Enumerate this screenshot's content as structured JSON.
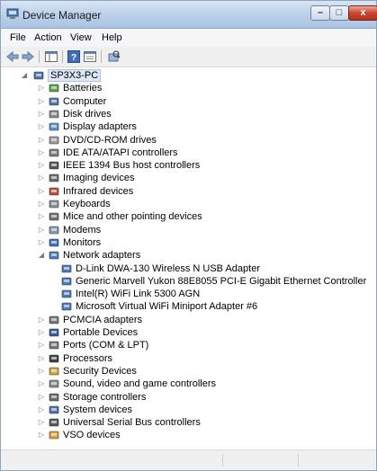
{
  "window": {
    "title": "Device Manager",
    "min": "–",
    "max": "□",
    "close": "x"
  },
  "menu": [
    "File",
    "Action",
    "View",
    "Help"
  ],
  "tree": {
    "root": "SP3X3-PC",
    "categories": [
      {
        "label": "Batteries",
        "icon": "battery-icon",
        "expanded": false
      },
      {
        "label": "Computer",
        "icon": "computer-icon",
        "expanded": false
      },
      {
        "label": "Disk drives",
        "icon": "disk-drive-icon",
        "expanded": false
      },
      {
        "label": "Display adapters",
        "icon": "display-adapter-icon",
        "expanded": false
      },
      {
        "label": "DVD/CD-ROM drives",
        "icon": "dvd-drive-icon",
        "expanded": false
      },
      {
        "label": "IDE ATA/ATAPI controllers",
        "icon": "ide-controller-icon",
        "expanded": false
      },
      {
        "label": "IEEE 1394 Bus host controllers",
        "icon": "ieee1394-icon",
        "expanded": false
      },
      {
        "label": "Imaging devices",
        "icon": "imaging-device-icon",
        "expanded": false
      },
      {
        "label": "Infrared devices",
        "icon": "infrared-device-icon",
        "expanded": false
      },
      {
        "label": "Keyboards",
        "icon": "keyboard-icon",
        "expanded": false
      },
      {
        "label": "Mice and other pointing devices",
        "icon": "mouse-icon",
        "expanded": false
      },
      {
        "label": "Modems",
        "icon": "modem-icon",
        "expanded": false
      },
      {
        "label": "Monitors",
        "icon": "monitor-icon",
        "expanded": false
      },
      {
        "label": "Network adapters",
        "icon": "network-adapter-icon",
        "expanded": true,
        "children": [
          "D-Link DWA-130 Wireless N USB Adapter",
          "Generic Marvell Yukon 88E8055 PCI-E Gigabit Ethernet Controller",
          "Intel(R) WiFi Link 5300 AGN",
          "Microsoft Virtual WiFi Miniport Adapter #6"
        ]
      },
      {
        "label": "PCMCIA adapters",
        "icon": "pcmcia-icon",
        "expanded": false
      },
      {
        "label": "Portable Devices",
        "icon": "portable-device-icon",
        "expanded": false
      },
      {
        "label": "Ports (COM & LPT)",
        "icon": "port-icon",
        "expanded": false
      },
      {
        "label": "Processors",
        "icon": "processor-icon",
        "expanded": false
      },
      {
        "label": "Security Devices",
        "icon": "security-device-icon",
        "expanded": false
      },
      {
        "label": "Sound, video and game controllers",
        "icon": "sound-icon",
        "expanded": false
      },
      {
        "label": "Storage controllers",
        "icon": "storage-controller-icon",
        "expanded": false
      },
      {
        "label": "System devices",
        "icon": "system-device-icon",
        "expanded": false
      },
      {
        "label": "Universal Serial Bus controllers",
        "icon": "usb-icon",
        "expanded": false
      },
      {
        "label": "VSO devices",
        "icon": "vso-device-icon",
        "expanded": false
      }
    ]
  },
  "colors": {
    "titlebar": "#bcd1ea",
    "selection": "#dde8f7",
    "close": "#c9462c"
  }
}
